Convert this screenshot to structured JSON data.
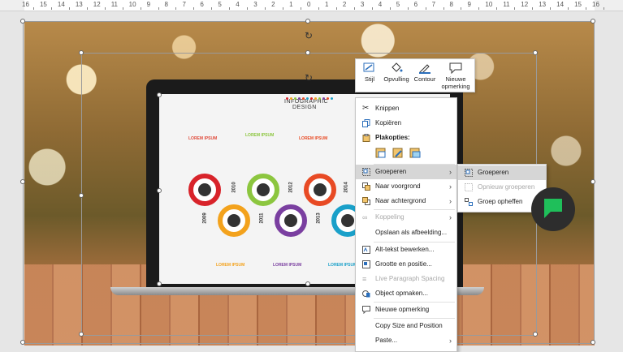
{
  "ruler": {
    "labels": [
      "16",
      "15",
      "14",
      "13",
      "12",
      "11",
      "10",
      "9",
      "8",
      "7",
      "6",
      "5",
      "4",
      "3",
      "2",
      "1",
      "0",
      "1",
      "2",
      "3",
      "4",
      "5",
      "6",
      "7",
      "8",
      "9",
      "10",
      "11",
      "12",
      "13",
      "14",
      "15",
      "16"
    ]
  },
  "infographic": {
    "title_line1": "INFOGRAPHIC",
    "title_line2": "DESIGN",
    "lorem_label": "LOREM IPSUM",
    "years": [
      "2009",
      "2010",
      "2011",
      "2012",
      "2013",
      "2014"
    ],
    "ring_colors": [
      "#d8232a",
      "#f3a21c",
      "#8cc63f",
      "#7a3fa0",
      "#e84a24",
      "#1aa0c9"
    ]
  },
  "toolbar": {
    "style_label": "Stijl",
    "fill_label": "Opvulling",
    "outline_label": "Contour",
    "new_comment_label_1": "Nieuwe",
    "new_comment_label_2": "opmerking"
  },
  "context_menu": {
    "cut": "Knippen",
    "copy": "Kopiëren",
    "paste_options": "Plakopties:",
    "group": "Groeperen",
    "bring_forward": "Naar voorgrond",
    "send_backward": "Naar achtergrond",
    "link": "Koppeling",
    "save_as_picture": "Opslaan als afbeelding...",
    "edit_alt_text": "Alt-tekst bewerken...",
    "size_position": "Grootte en positie...",
    "live_paragraph": "Live Paragraph Spacing",
    "format_object": "Object opmaken...",
    "new_comment": "Nieuwe opmerking",
    "copy_size_position": "Copy Size and Position",
    "paste": "Paste..."
  },
  "submenu": {
    "group": "Groeperen",
    "regroup": "Opnieuw groeperen",
    "ungroup": "Groep opheffen"
  },
  "colors": {
    "accent_green": "#1fbf5a",
    "menu_highlight": "#d6d6d6",
    "disabled_text": "#a8a8a8"
  }
}
